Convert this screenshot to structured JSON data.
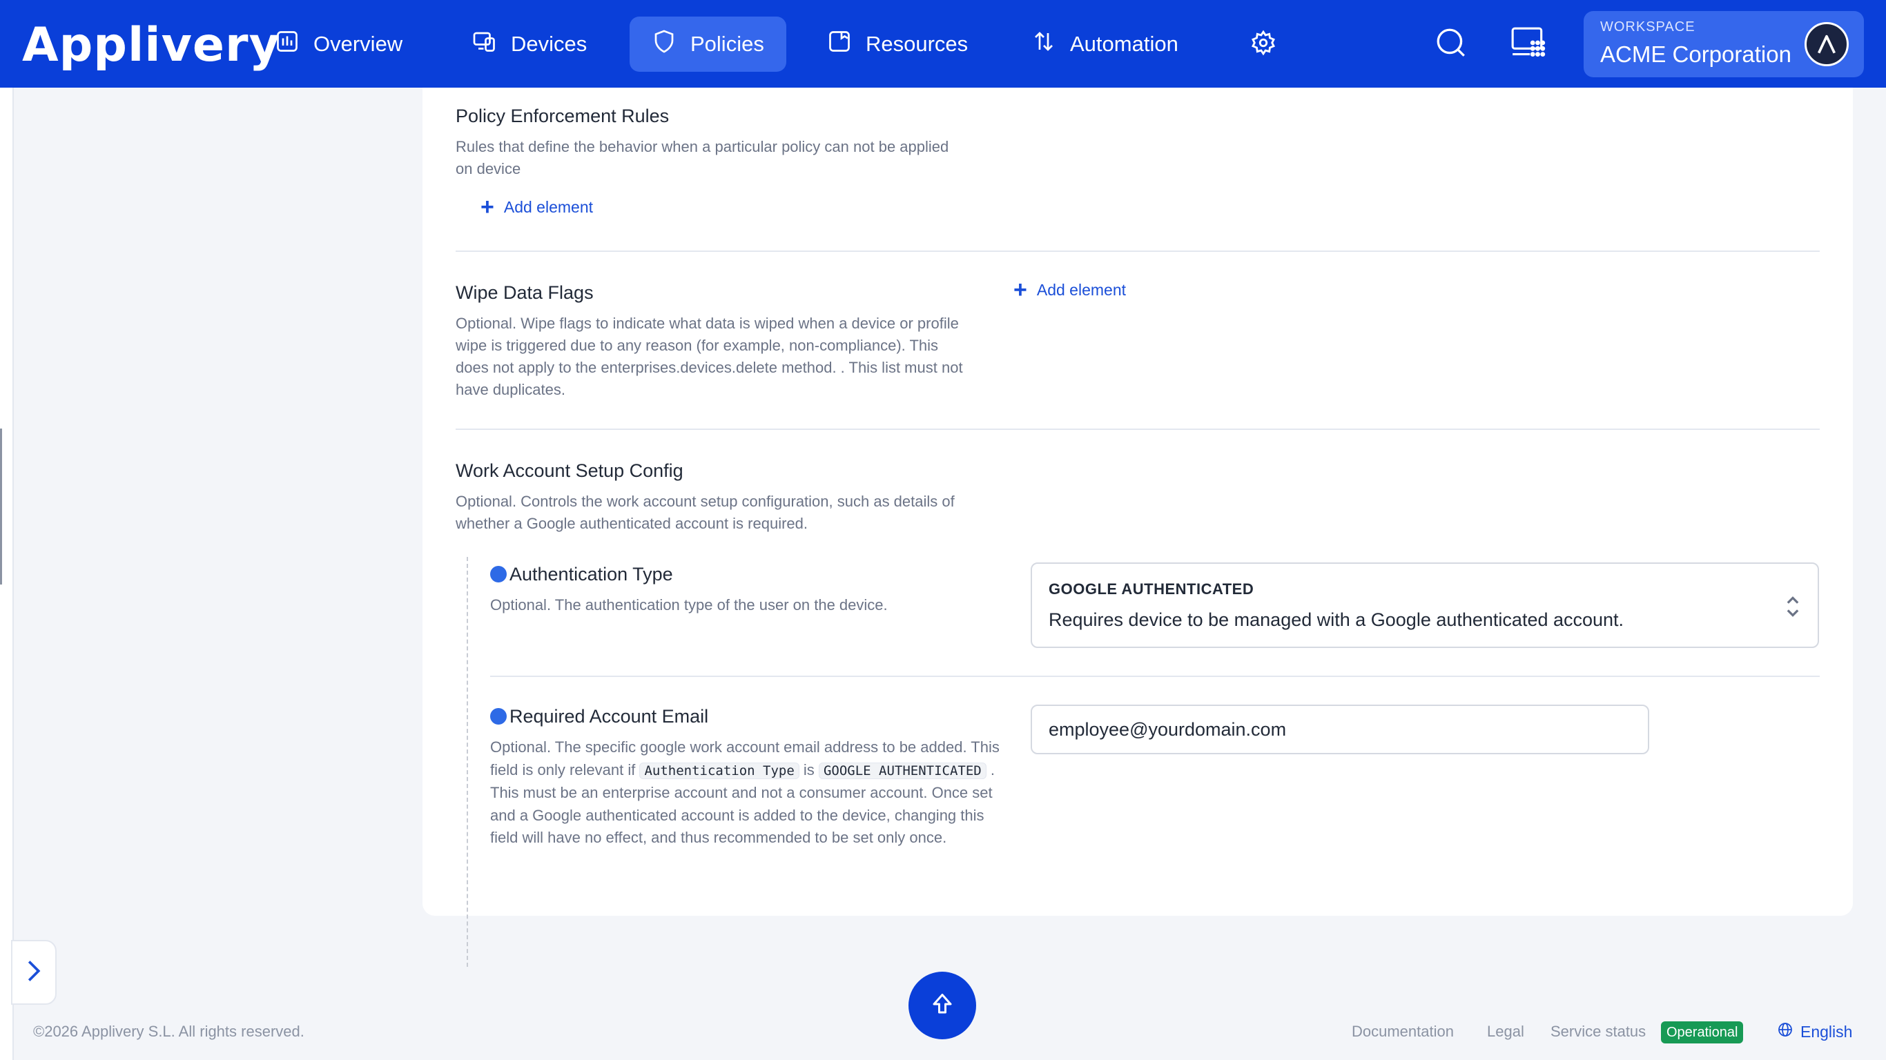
{
  "app": {
    "logo_text": "Applivery"
  },
  "nav": {
    "items": [
      {
        "label": "Overview",
        "icon": "chart-icon"
      },
      {
        "label": "Devices",
        "icon": "devices-icon"
      },
      {
        "label": "Policies",
        "icon": "shield-icon",
        "active": true
      },
      {
        "label": "Resources",
        "icon": "folder-icon"
      },
      {
        "label": "Automation",
        "icon": "automation-icon"
      }
    ],
    "settings_icon": "gear-icon",
    "search_icon": "search-icon",
    "apps_icon": "apps-grid-icon"
  },
  "workspace": {
    "caption": "WORKSPACE",
    "name": "ACME Corporation",
    "avatar_letter": "A"
  },
  "sections": {
    "enforcement": {
      "title": "Policy Enforcement Rules",
      "description": "Rules that define the behavior when a particular policy can not be applied on device",
      "add_label": "Add element"
    },
    "wipe": {
      "title": "Wipe Data Flags",
      "description": "Optional. Wipe flags to indicate what data is wiped when a device or profile wipe is triggered due to any reason (for example, non-compliance). This does not apply to the enterprises.devices.delete method. . This list must not have duplicates.",
      "add_label": "Add element"
    },
    "work_account": {
      "title": "Work Account Setup Config",
      "description": "Optional. Controls the work account setup configuration, such as details of whether a Google authenticated account is required.",
      "auth_type": {
        "title": "Authentication Type",
        "description": "Optional. The authentication type of the user on the device.",
        "selected_label": "GOOGLE AUTHENTICATED",
        "selected_description": "Requires device to be managed with a Google authenticated account."
      },
      "required_email": {
        "title": "Required Account Email",
        "value": "employee@yourdomain.com",
        "desc_part1": "Optional. The specific google work account email address to be added. This field is only relevant if",
        "code1": "Authentication Type",
        "desc_part2": "is",
        "code2": "GOOGLE AUTHENTICATED",
        "desc_part3": ". This must be an enterprise account and not a consumer account. Once set and a Google authenticated account is added to the device, changing this field will have no effect, and thus recommended to be set only once."
      }
    }
  },
  "footer": {
    "copyright": "©2026 Applivery S.L. All rights reserved.",
    "documentation": "Documentation",
    "legal": "Legal",
    "service_status": "Service status",
    "status_badge": "Operational",
    "language": "English"
  },
  "colors": {
    "brand": "#0a3fd9",
    "active_nav": "#3567ec",
    "link": "#1b4fd8",
    "status_ok": "#179a55"
  }
}
